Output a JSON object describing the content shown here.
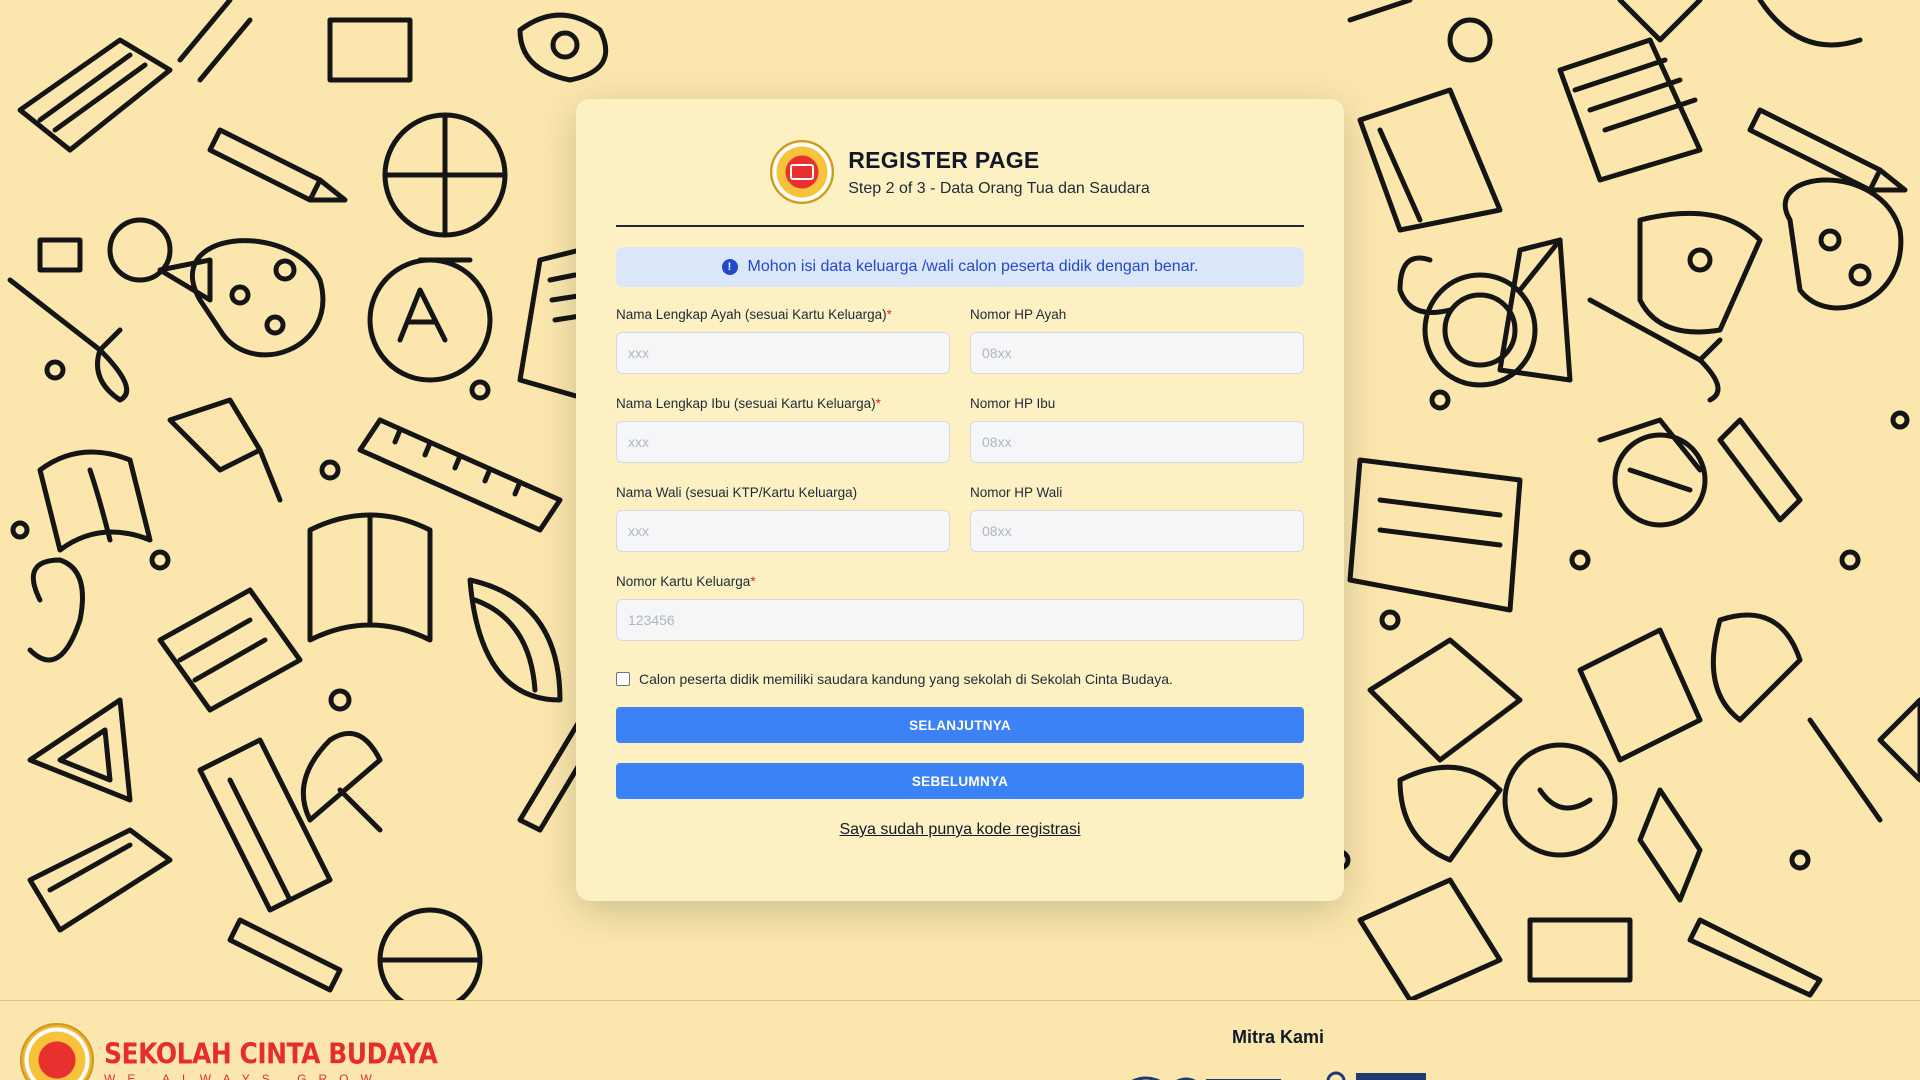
{
  "page": {
    "title": "REGISTER PAGE",
    "subtitle": "Step 2 of 3 - Data Orang Tua dan Saudara"
  },
  "alert": {
    "text": "Mohon isi data keluarga /wali calon peserta didik dengan benar.",
    "icon": "info-icon"
  },
  "form": {
    "father_name": {
      "label": "Nama Lengkap Ayah (sesuai Kartu Keluarga)",
      "required": "*",
      "placeholder": "xxx"
    },
    "father_phone": {
      "label": "Nomor HP Ayah",
      "placeholder": "08xx"
    },
    "mother_name": {
      "label": "Nama Lengkap Ibu (sesuai Kartu Keluarga)",
      "required": "*",
      "placeholder": "xxx"
    },
    "mother_phone": {
      "label": "Nomor HP Ibu",
      "placeholder": "08xx"
    },
    "guardian_name": {
      "label": "Nama Wali (sesuai KTP/Kartu Keluarga)",
      "placeholder": "xxx"
    },
    "guardian_phone": {
      "label": "Nomor HP Wali",
      "placeholder": "08xx"
    },
    "family_card": {
      "label": "Nomor Kartu Keluarga",
      "required": "*",
      "placeholder": "123456"
    },
    "sibling_checkbox": {
      "label": "Calon peserta didik memiliki saudara kandung yang sekolah di Sekolah Cinta Budaya.",
      "checked": false
    }
  },
  "buttons": {
    "next": "SELANJUTNYA",
    "prev": "SEBELUMNYA",
    "have_code": "Saya sudah punya kode registrasi"
  },
  "footer": {
    "brand_name": "SEKOLAH CINTA BUDAYA",
    "brand_tagline": "WE ALWAYS GROW",
    "partners_title": "Mitra Kami"
  },
  "colors": {
    "background": "#fbe7ad",
    "card": "#fdf1c4",
    "primary_button": "#3b82f6",
    "alert_bg": "#dbe6fb",
    "alert_text": "#2149c9",
    "brand_red": "#e52d2a"
  }
}
